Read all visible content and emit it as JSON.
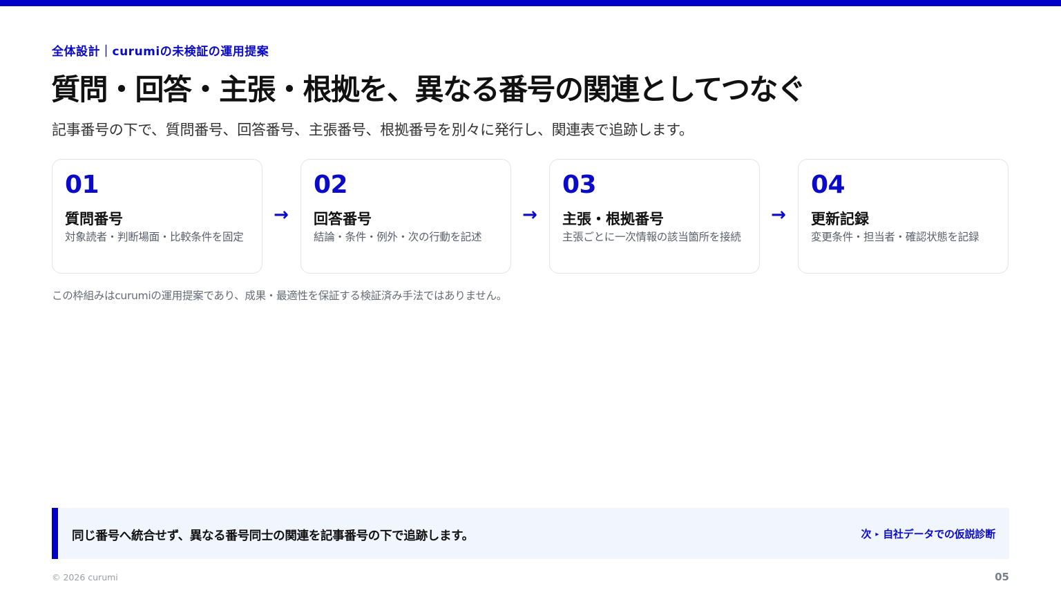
{
  "eyebrow": "全体設計｜curumiの未検証の運用提案",
  "title": "質問・回答・主張・根拠を、異なる番号の関連としてつなぐ",
  "subtitle": "記事番号の下で、質問番号、回答番号、主張番号、根拠番号を別々に発行し、関連表で追跡します。",
  "steps": [
    {
      "num": "01",
      "title": "質問番号",
      "desc": "対象読者・判断場面・比較条件を固定"
    },
    {
      "num": "02",
      "title": "回答番号",
      "desc": "結論・条件・例外・次の行動を記述"
    },
    {
      "num": "03",
      "title": "主張・根拠番号",
      "desc": "主張ごとに一次情報の該当箇所を接続"
    },
    {
      "num": "04",
      "title": "更新記録",
      "desc": "変更条件・担当者・確認状態を記録"
    }
  ],
  "arrow_glyph": "→",
  "note": "この枠組みはcurumiの運用提案であり、成果・最適性を保証する検証済み手法ではありません。",
  "footer": {
    "main": "同じ番号へ統合せず、異なる番号同士の関連を記事番号の下で追跡します。",
    "next_label": "次",
    "next_glyph": "▸",
    "next_target": "自社データでの仮説診断"
  },
  "copyright": "© 2026 curumi",
  "page_number": "05",
  "colors": {
    "accent": "#0000c8",
    "footer_bg": "#f1f5fd"
  }
}
